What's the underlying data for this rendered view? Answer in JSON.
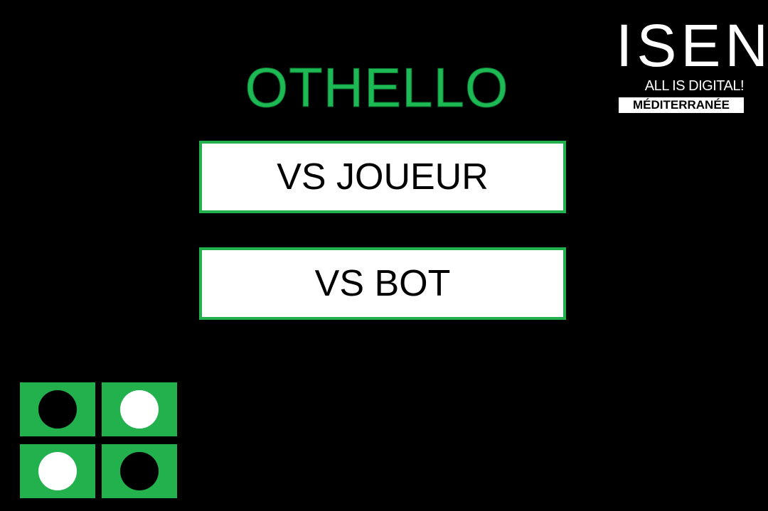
{
  "title": "OTHELLO",
  "menu": {
    "vs_player_label": "VS JOUEUR",
    "vs_bot_label": "VS BOT"
  },
  "logo": {
    "name": "ISEN",
    "tagline": "ALL IS DIGITAL!",
    "campus": "MÉDITERRANÉE"
  },
  "board_preview": {
    "rows": [
      [
        "black",
        "white"
      ],
      [
        "white",
        "black"
      ]
    ]
  },
  "colors": {
    "background": "#000000",
    "accent_green": "#22b14c",
    "button_bg": "#ffffff",
    "text": "#000000"
  }
}
